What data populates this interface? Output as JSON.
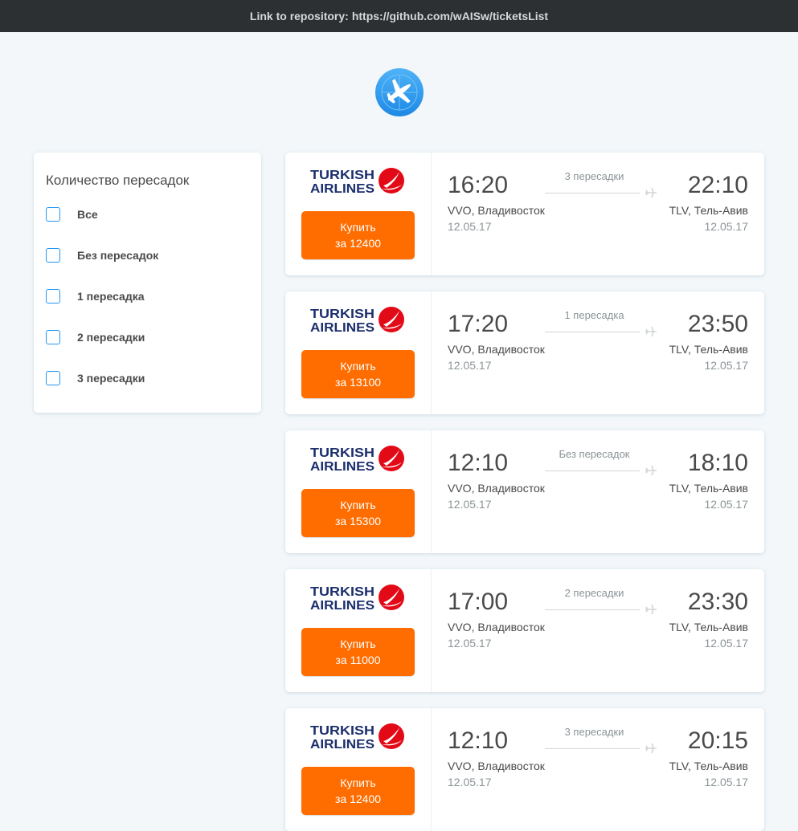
{
  "topbar": {
    "label": "Link to repository:",
    "url": "https://github.com/wAISw/ticketsList"
  },
  "logo": {
    "icon": "airplane-logo-icon",
    "color": "#2196f3"
  },
  "filter": {
    "title": "Количество пересадок",
    "options": [
      {
        "label": "Все",
        "checked": false
      },
      {
        "label": "Без пересадок",
        "checked": false
      },
      {
        "label": "1 пересадка",
        "checked": false
      },
      {
        "label": "2 пересадки",
        "checked": false
      },
      {
        "label": "3 пересадки",
        "checked": false
      }
    ]
  },
  "buy_button": {
    "label": "Купить"
  },
  "tickets": [
    {
      "airline": "TURKISH AIRLINES",
      "price_label": "за 12400",
      "departure_time": "16:20",
      "origin": "VVO, Владивосток",
      "departure_date": "12.05.17",
      "stops": "3 пересадки",
      "arrival_time": "22:10",
      "destination": "TLV, Тель-Авив",
      "arrival_date": "12.05.17"
    },
    {
      "airline": "TURKISH AIRLINES",
      "price_label": "за 13100",
      "departure_time": "17:20",
      "origin": "VVO, Владивосток",
      "departure_date": "12.05.17",
      "stops": "1 пересадка",
      "arrival_time": "23:50",
      "destination": "TLV, Тель-Авив",
      "arrival_date": "12.05.17"
    },
    {
      "airline": "TURKISH AIRLINES",
      "price_label": "за 15300",
      "departure_time": "12:10",
      "origin": "VVO, Владивосток",
      "departure_date": "12.05.17",
      "stops": "Без пересадок",
      "arrival_time": "18:10",
      "destination": "TLV, Тель-Авив",
      "arrival_date": "12.05.17"
    },
    {
      "airline": "TURKISH AIRLINES",
      "price_label": "за 11000",
      "departure_time": "17:00",
      "origin": "VVO, Владивосток",
      "departure_date": "12.05.17",
      "stops": "2 пересадки",
      "arrival_time": "23:30",
      "destination": "TLV, Тель-Авив",
      "arrival_date": "12.05.17"
    },
    {
      "airline": "TURKISH AIRLINES",
      "price_label": "за 12400",
      "departure_time": "12:10",
      "origin": "VVO, Владивосток",
      "departure_date": "12.05.17",
      "stops": "3 пересадки",
      "arrival_time": "20:15",
      "destination": "TLV, Тель-Авив",
      "arrival_date": "12.05.17"
    }
  ],
  "colors": {
    "accent": "#ff6d00",
    "checkbox": "#2196f3",
    "airline_navy": "#1c2f6e",
    "airline_red": "#e30a17"
  }
}
